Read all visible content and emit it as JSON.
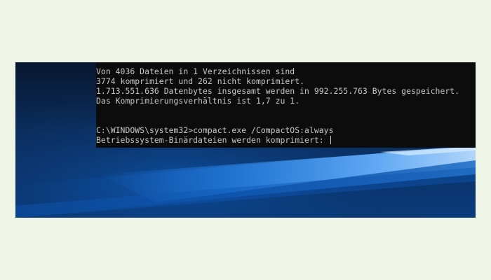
{
  "terminal": {
    "lines": [
      "Von 4036 Dateien in 1 Verzeichnissen sind",
      "3774 komprimiert und 262 nicht komprimiert.",
      "1.713.551.636 Datenbytes insgesamt werden in 992.255.763 Bytes gespeichert.",
      "Das Komprimierungsverhältnis ist 1,7 zu 1.",
      "",
      "",
      "C:\\WINDOWS\\system32>compact.exe /CompactOS:always",
      "Betriebssystem-Binärdateien werden komprimiert: "
    ]
  },
  "colors": {
    "page_background": "#eef5e6",
    "terminal_background": "#0c0c0c",
    "terminal_text": "#c8c8c8",
    "desktop_accent": "#0a5fc4"
  }
}
